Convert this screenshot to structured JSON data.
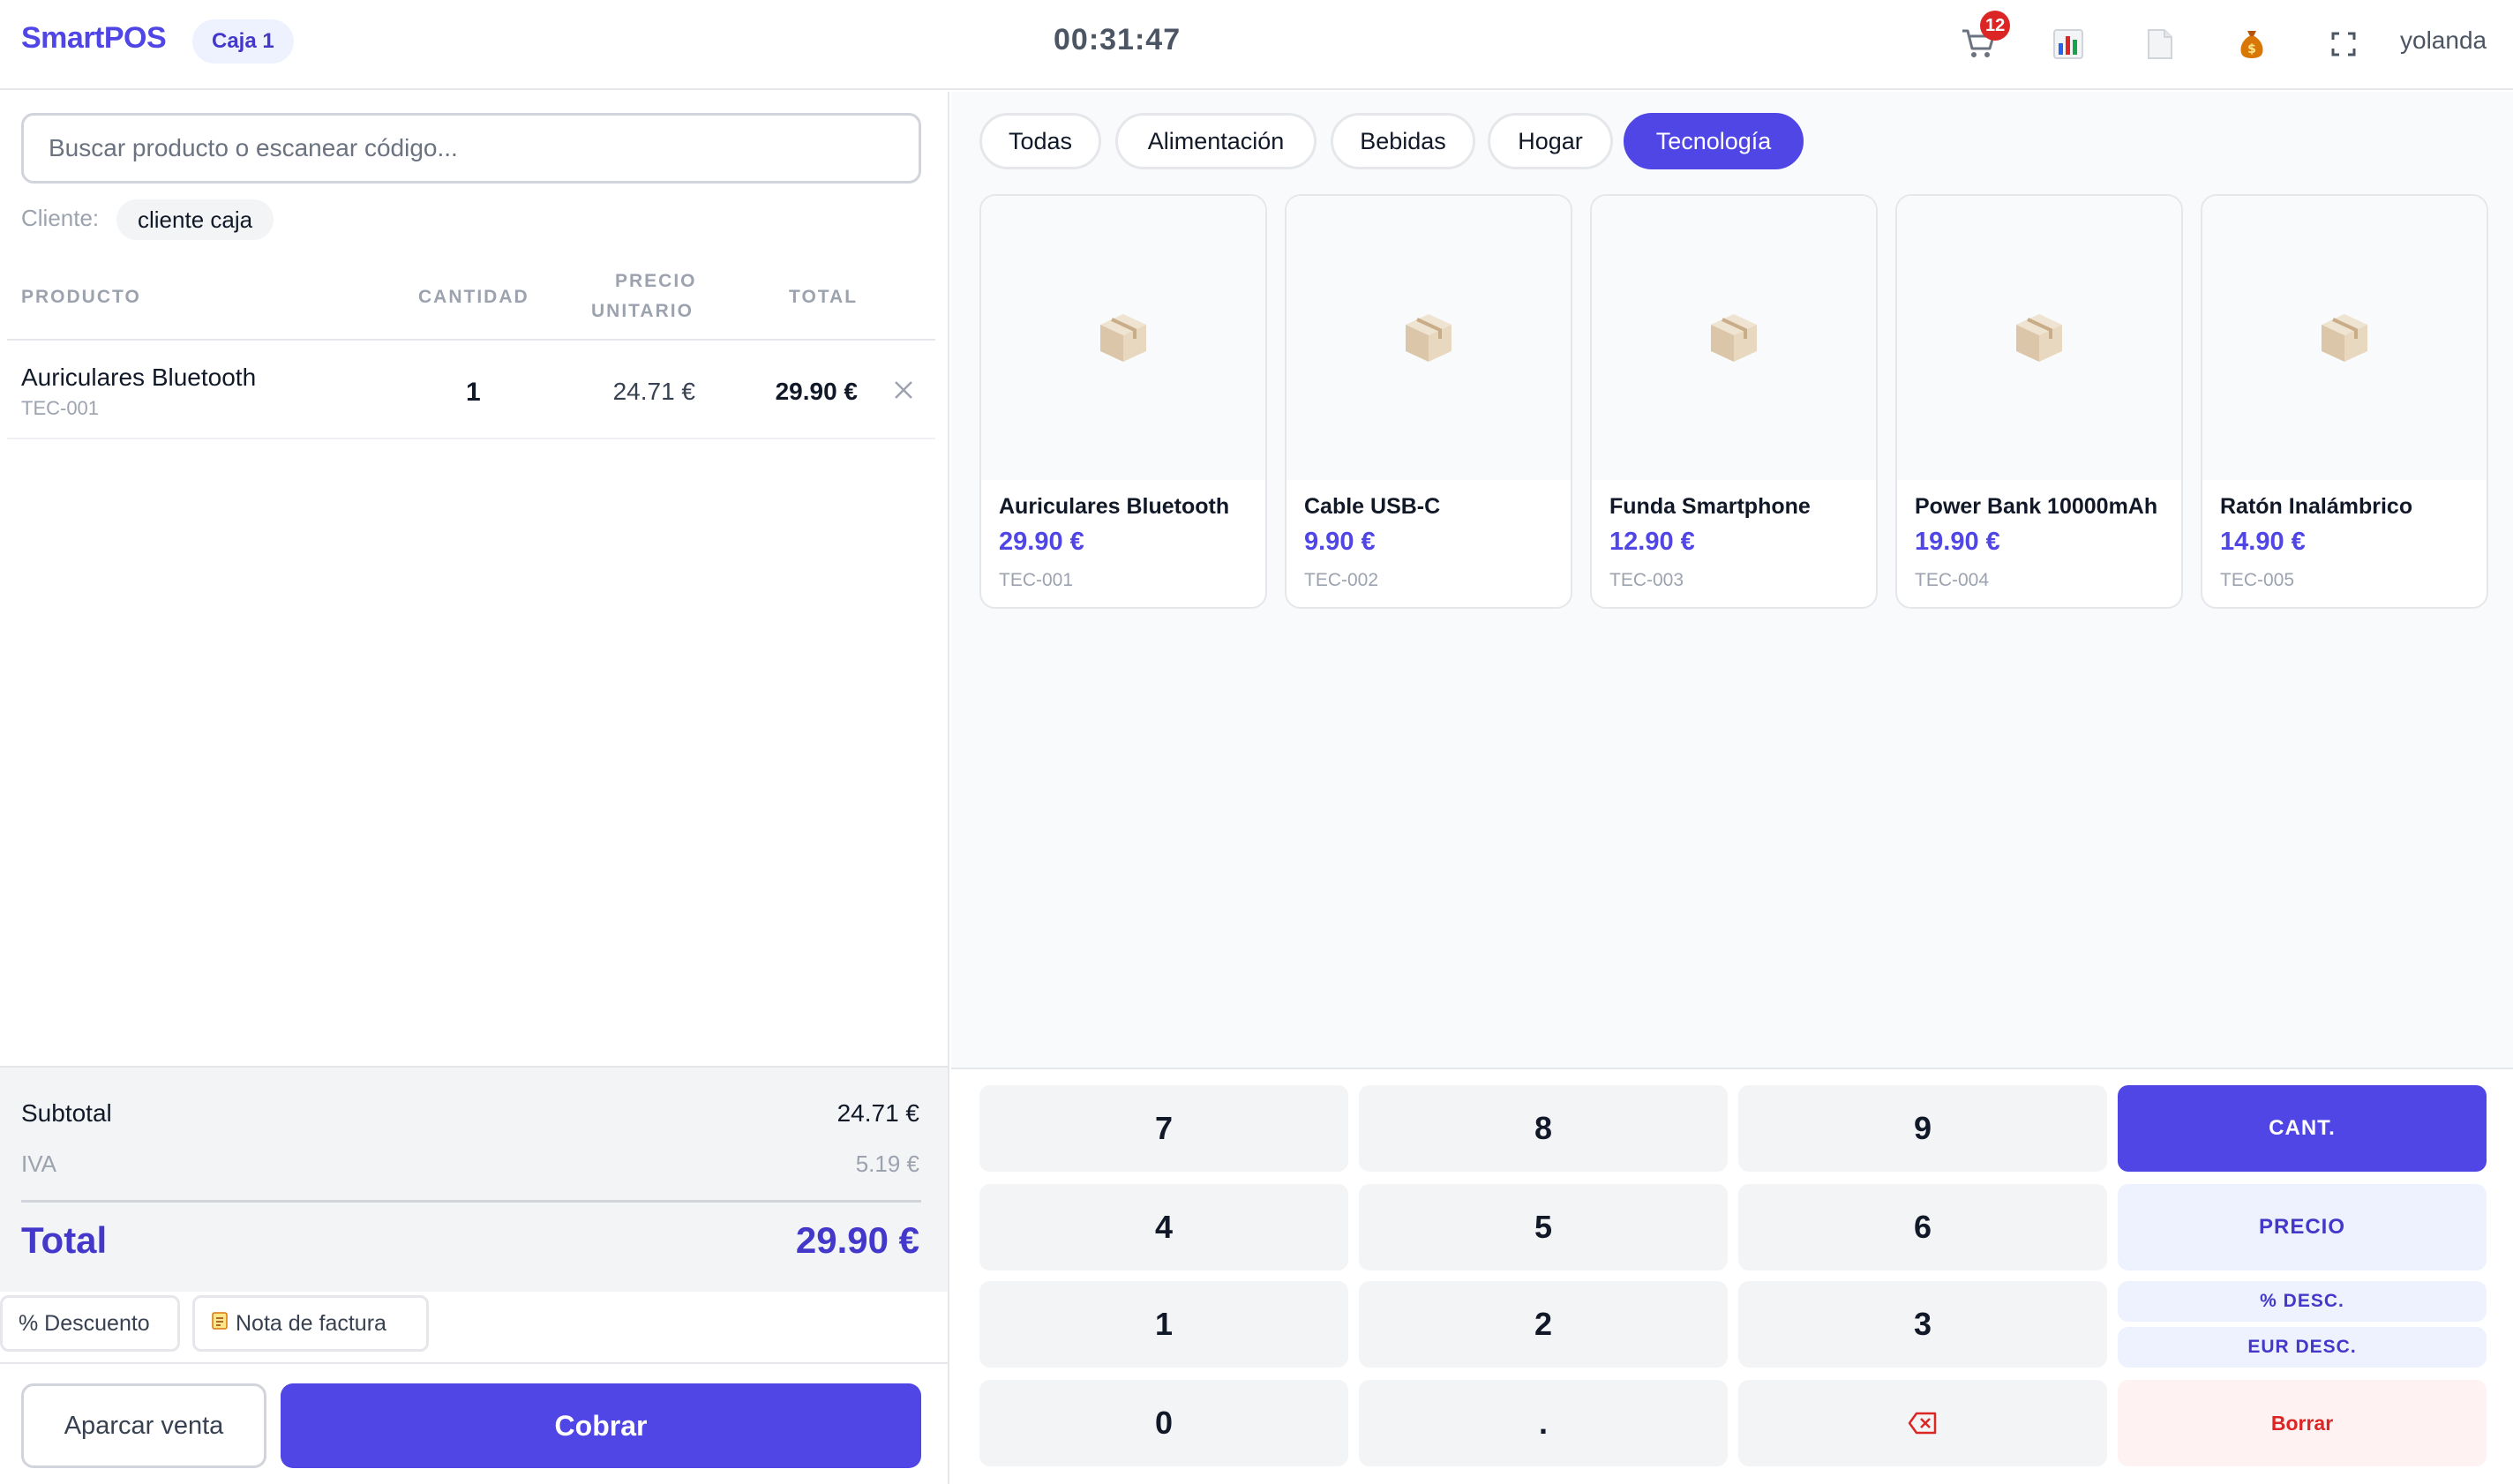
{
  "header": {
    "brand": "SmartPOS",
    "register": "Caja 1",
    "clock": "00:31:47",
    "cart_count": "12",
    "icons": [
      "cart-icon",
      "chart-icon",
      "document-icon",
      "money-bag-icon",
      "fullscreen-icon"
    ],
    "user": "yolanda"
  },
  "search": {
    "placeholder": "Buscar producto o escanear código..."
  },
  "client": {
    "label": "Cliente:",
    "value": "cliente caja"
  },
  "cart_table": {
    "headers": {
      "product": "PRODUCTO",
      "quantity": "CANTIDAD",
      "unit_price_1": "PRECIO",
      "unit_price_2": "UNITARIO",
      "total": "TOTAL"
    },
    "rows": [
      {
        "name": "Auriculares Bluetooth",
        "sku": "TEC-001",
        "quantity": "1",
        "unit_price": "24.71 €",
        "total": "29.90 €"
      }
    ]
  },
  "summary": {
    "subtotal_label": "Subtotal",
    "subtotal": "24.71 €",
    "tax_label": "IVA",
    "tax": "5.19 €",
    "total_label": "Total",
    "total": "29.90 €"
  },
  "tools": {
    "discount": "% Descuento",
    "invoice_note": "Nota de factura"
  },
  "actions": {
    "park": "Aparcar venta",
    "pay": "Cobrar"
  },
  "categories": [
    {
      "label": "Todas",
      "active": false
    },
    {
      "label": "Alimentación",
      "active": false
    },
    {
      "label": "Bebidas",
      "active": false
    },
    {
      "label": "Hogar",
      "active": false
    },
    {
      "label": "Tecnología",
      "active": true
    }
  ],
  "products": [
    {
      "name": "Auriculares Bluetooth",
      "price": "29.90 €",
      "sku": "TEC-001"
    },
    {
      "name": "Cable USB-C",
      "price": "9.90 €",
      "sku": "TEC-002"
    },
    {
      "name": "Funda Smartphone",
      "price": "12.90 €",
      "sku": "TEC-003"
    },
    {
      "name": "Power Bank 10000mAh",
      "price": "19.90 €",
      "sku": "TEC-004"
    },
    {
      "name": "Ratón Inalámbrico",
      "price": "14.90 €",
      "sku": "TEC-005"
    }
  ],
  "keypad": {
    "digits": [
      "7",
      "8",
      "9",
      "4",
      "5",
      "6",
      "1",
      "2",
      "3",
      "0",
      "."
    ],
    "qty_mode": "CANT.",
    "price_mode": "PRECIO",
    "pct_discount": "% DESC.",
    "eur_discount": "EUR DESC.",
    "clear": "Borrar"
  },
  "colors": {
    "accent": "#4f46e5",
    "danger": "#dc2626"
  }
}
